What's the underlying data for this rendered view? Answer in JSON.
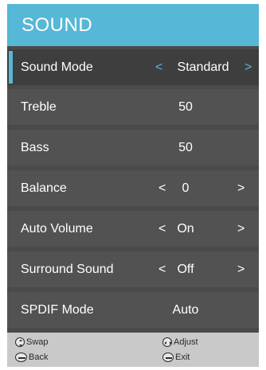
{
  "header": {
    "title": "SOUND"
  },
  "rows": [
    {
      "label": "Sound Mode",
      "value": "Standard",
      "left_arrow": "<",
      "right_arrow": ">"
    },
    {
      "label": "Treble",
      "value": "50"
    },
    {
      "label": "Bass",
      "value": "50"
    },
    {
      "label": "Balance",
      "value": "0",
      "left_arrow": "<",
      "right_arrow": ">"
    },
    {
      "label": "Auto Volume",
      "value": "On",
      "left_arrow": "<",
      "right_arrow": ">"
    },
    {
      "label": "Surround Sound",
      "value": "Off",
      "left_arrow": "<",
      "right_arrow": ">"
    },
    {
      "label": "SPDIF Mode",
      "value": "Auto"
    }
  ],
  "footer": {
    "swap": "Swap",
    "adjust": "Adjust",
    "back": "Back",
    "exit": "Exit",
    "icons": [
      "up-down-icon",
      "left-right-icon",
      "menu-icon",
      "exit-icon"
    ]
  },
  "colors": {
    "accent": "#56b7d6",
    "panel": "#4a4a4a",
    "footer": "#c9c9c9"
  }
}
